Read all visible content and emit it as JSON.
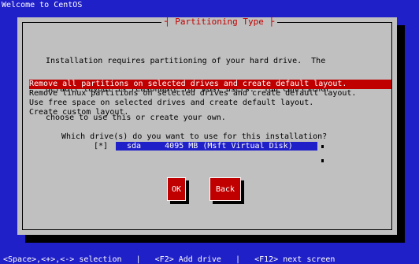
{
  "window": {
    "title": "Welcome to CentOS"
  },
  "dialog": {
    "title": "Partitioning Type",
    "intro_lines": [
      "Installation requires partitioning of your hard drive.  The",
      "default layout is reasonable for most users.  You can either",
      "choose to use this or create your own."
    ],
    "options": [
      "Remove all partitions on selected drives and create default layout.",
      "Remove linux partitions on selected drives and create default layout.",
      "Use free space on selected drives and create default layout.",
      "Create custom layout."
    ],
    "selected_option_index": 0,
    "drive_question": "Which drive(s) do you want to use for this installation?",
    "drive": {
      "checkbox": "[*]",
      "label": "sda     4095 MB (Msft Virtual Disk)"
    },
    "buttons": {
      "ok": "OK",
      "back": "Back"
    }
  },
  "footer": {
    "hint": "<Space>,<+>,<-> selection   |   <F2> Add drive   |   <F12> next screen"
  },
  "colors": {
    "background": "#2020c8",
    "dialog": "#c0c0c0",
    "accent": "#c00000",
    "text": "#000000",
    "inverse_text": "#ffffff"
  }
}
